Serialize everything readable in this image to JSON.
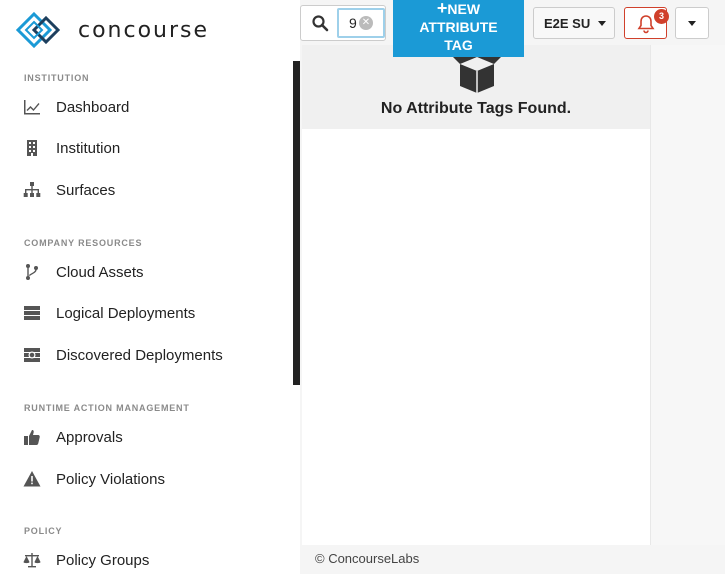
{
  "brand": {
    "name": "concourse",
    "logo_icon": "concourse-logo-icon"
  },
  "sidebar": {
    "sections": [
      {
        "title": "INSTITUTION"
      },
      {
        "title": "COMPANY RESOURCES"
      },
      {
        "title": "RUNTIME ACTION MANAGEMENT"
      },
      {
        "title": "POLICY"
      }
    ],
    "items": [
      {
        "label": "Dashboard",
        "icon": "chart-line-icon"
      },
      {
        "label": "Institution",
        "icon": "building-icon"
      },
      {
        "label": "Surfaces",
        "icon": "sitemap-icon"
      },
      {
        "label": "Cloud Assets",
        "icon": "code-branch-icon"
      },
      {
        "label": "Logical Deployments",
        "icon": "server-icon"
      },
      {
        "label": "Discovered Deployments",
        "icon": "search-deployments-icon"
      },
      {
        "label": "Approvals",
        "icon": "thumbs-up-icon"
      },
      {
        "label": "Policy Violations",
        "icon": "warning-icon"
      },
      {
        "label": "Policy Groups",
        "icon": "balance-scale-icon"
      }
    ]
  },
  "toolbar": {
    "search_value": "9",
    "new_button": {
      "plus": "+",
      "line1": "NEW",
      "line2": "ATTRIBUTE",
      "line3": "TAG"
    },
    "tenant_label": "E2E SU",
    "notification_count": "3"
  },
  "main": {
    "empty_message": "No Attribute Tags Found.",
    "empty_icon": "open-box-icon"
  },
  "footer": {
    "text": "© ConcourseLabs"
  },
  "colors": {
    "accent": "#1b9ad6",
    "alert": "#d0402b"
  }
}
